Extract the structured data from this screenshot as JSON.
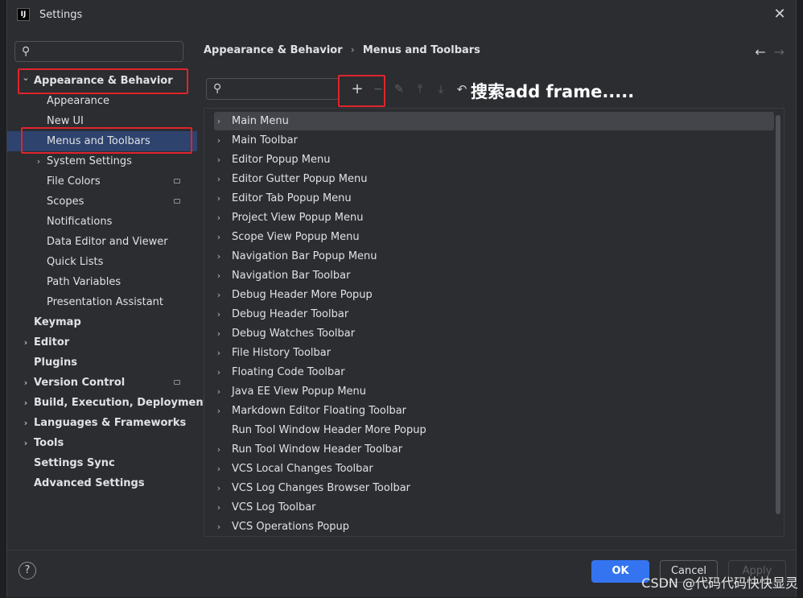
{
  "window": {
    "title": "Settings",
    "app_icon": "IJ",
    "close_symbol": "✕"
  },
  "sidebar": {
    "search_placeholder": "",
    "items": [
      {
        "label": "Appearance & Behavior",
        "level": 0,
        "expanded": true,
        "bold": true,
        "chevron": "down"
      },
      {
        "label": "Appearance",
        "level": 1
      },
      {
        "label": "New UI",
        "level": 1
      },
      {
        "label": "Menus and Toolbars",
        "level": 1,
        "selected": true
      },
      {
        "label": "System Settings",
        "level": 1,
        "chevron": "right"
      },
      {
        "label": "File Colors",
        "level": 1,
        "badge": true
      },
      {
        "label": "Scopes",
        "level": 1,
        "badge": true
      },
      {
        "label": "Notifications",
        "level": 1
      },
      {
        "label": "Data Editor and Viewer",
        "level": 1
      },
      {
        "label": "Quick Lists",
        "level": 1
      },
      {
        "label": "Path Variables",
        "level": 1
      },
      {
        "label": "Presentation Assistant",
        "level": 1
      },
      {
        "label": "Keymap",
        "level": 0,
        "bold": true
      },
      {
        "label": "Editor",
        "level": 0,
        "bold": true,
        "chevron": "right"
      },
      {
        "label": "Plugins",
        "level": 0,
        "bold": true
      },
      {
        "label": "Version Control",
        "level": 0,
        "bold": true,
        "chevron": "right",
        "badge": true
      },
      {
        "label": "Build, Execution, Deployment",
        "level": 0,
        "bold": true,
        "chevron": "right"
      },
      {
        "label": "Languages & Frameworks",
        "level": 0,
        "bold": true,
        "chevron": "right"
      },
      {
        "label": "Tools",
        "level": 0,
        "bold": true,
        "chevron": "right"
      },
      {
        "label": "Settings Sync",
        "level": 0,
        "bold": true
      },
      {
        "label": "Advanced Settings",
        "level": 0,
        "bold": true
      }
    ]
  },
  "breadcrumb": {
    "parent": "Appearance & Behavior",
    "separator": "›",
    "current": "Menus and Toolbars"
  },
  "nav": {
    "back": "←",
    "forward": "→"
  },
  "toolbar": {
    "search_placeholder": "",
    "add": "+",
    "remove": "−",
    "edit": "✎",
    "move_up": "⤒",
    "move_down": "⤓",
    "restore": "↶"
  },
  "annotation": "搜索add frame.....",
  "action_groups": [
    {
      "label": "Main Menu",
      "expandable": true,
      "highlighted": true
    },
    {
      "label": "Main Toolbar",
      "expandable": true
    },
    {
      "label": "Editor Popup Menu",
      "expandable": true
    },
    {
      "label": "Editor Gutter Popup Menu",
      "expandable": true
    },
    {
      "label": "Editor Tab Popup Menu",
      "expandable": true
    },
    {
      "label": "Project View Popup Menu",
      "expandable": true
    },
    {
      "label": "Scope View Popup Menu",
      "expandable": true
    },
    {
      "label": "Navigation Bar Popup Menu",
      "expandable": true
    },
    {
      "label": "Navigation Bar Toolbar",
      "expandable": true
    },
    {
      "label": "Debug Header More Popup",
      "expandable": true
    },
    {
      "label": "Debug Header Toolbar",
      "expandable": true
    },
    {
      "label": "Debug Watches Toolbar",
      "expandable": true
    },
    {
      "label": "File History Toolbar",
      "expandable": true
    },
    {
      "label": "Floating Code Toolbar",
      "expandable": true
    },
    {
      "label": "Java EE View Popup Menu",
      "expandable": true
    },
    {
      "label": "Markdown Editor Floating Toolbar",
      "expandable": true
    },
    {
      "label": "Run Tool Window Header More Popup",
      "expandable": false
    },
    {
      "label": "Run Tool Window Header Toolbar",
      "expandable": true
    },
    {
      "label": "VCS Local Changes Toolbar",
      "expandable": true
    },
    {
      "label": "VCS Log Changes Browser Toolbar",
      "expandable": true
    },
    {
      "label": "VCS Log Toolbar",
      "expandable": true
    },
    {
      "label": "VCS Operations Popup",
      "expandable": true
    }
  ],
  "footer": {
    "help": "?",
    "ok": "OK",
    "cancel": "Cancel",
    "apply": "Apply"
  },
  "watermark": "CSDN @代码代码快快显灵",
  "colors": {
    "accent": "#3574f0",
    "selection": "#2e436e",
    "annotation_box": "#e0242b",
    "background": "#2b2d30"
  }
}
